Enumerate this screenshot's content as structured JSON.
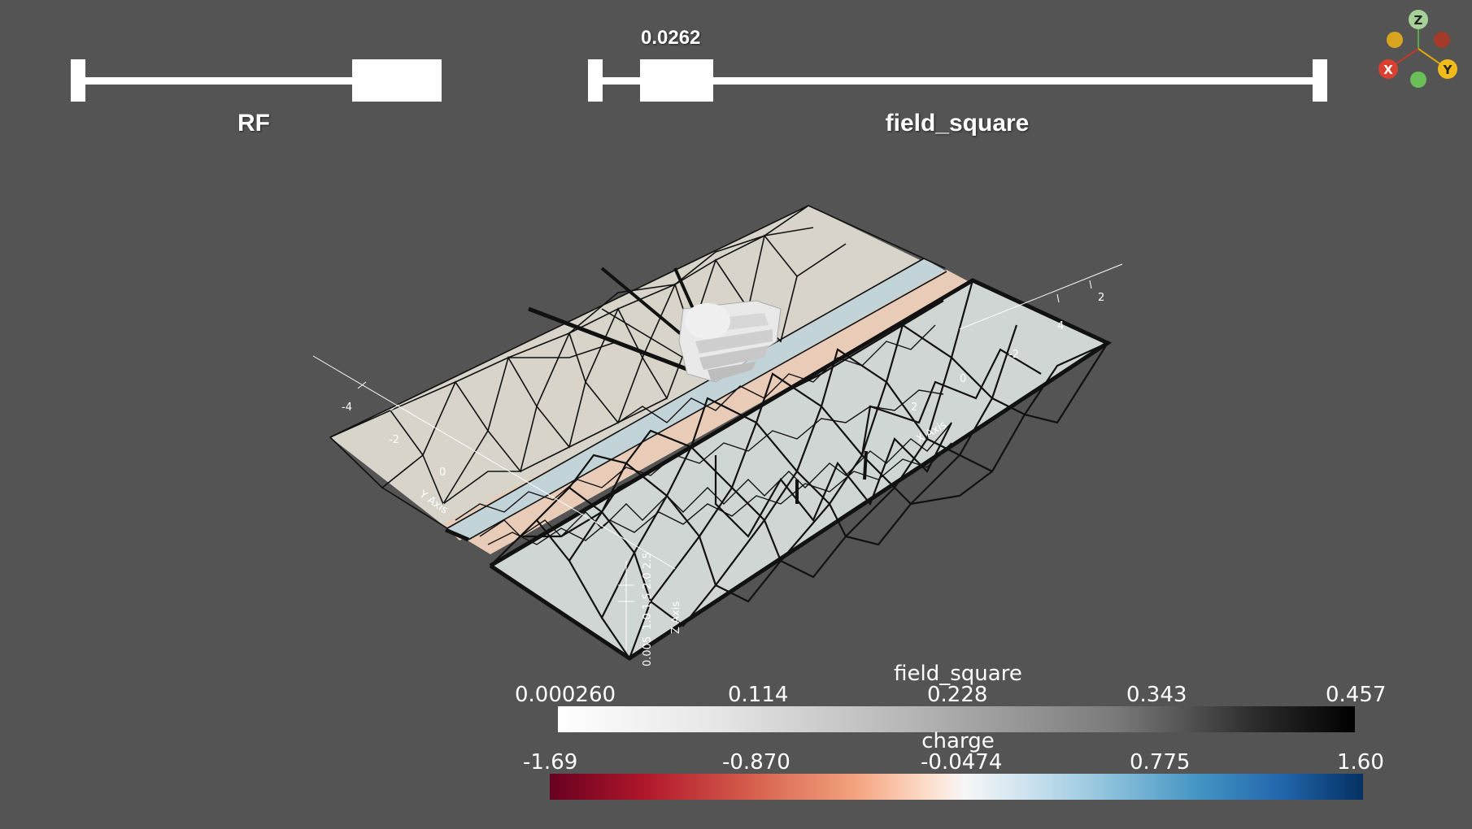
{
  "sliders": {
    "rf": {
      "title": "RF",
      "thumb_position": 0.78
    },
    "field_square": {
      "title": "field_square",
      "value": "0.0262",
      "thumb_position": 0.07
    }
  },
  "colorbars": {
    "field_square": {
      "title": "field_square",
      "ticks": [
        "0.000260",
        "0.114",
        "0.228",
        "0.343",
        "0.457"
      ]
    },
    "charge": {
      "title": "charge",
      "ticks": [
        "-1.69",
        "-0.870",
        "-0.0474",
        "0.775",
        "1.60"
      ]
    }
  },
  "orientation_axes": {
    "x": "X",
    "y": "Y",
    "z": "Z"
  },
  "axis_labels": {
    "x": [
      "-4",
      "-2",
      "0",
      "2",
      "4"
    ],
    "y": [
      "-2",
      "0",
      "2"
    ],
    "z": [
      "0.005",
      "1.0",
      "1.5",
      "2.0",
      "2.5"
    ],
    "x_title": "X Axis",
    "y_title": "Y Axis",
    "z_title": "Z Axis"
  },
  "colors": {
    "background": "#545454",
    "foreground": "#ffffff",
    "mesh_fill": "#d9d5cc",
    "mesh_fill_right": "#cfd5d2",
    "strip_peach": "#e6cbb8",
    "strip_blue": "#c0d2d8"
  }
}
